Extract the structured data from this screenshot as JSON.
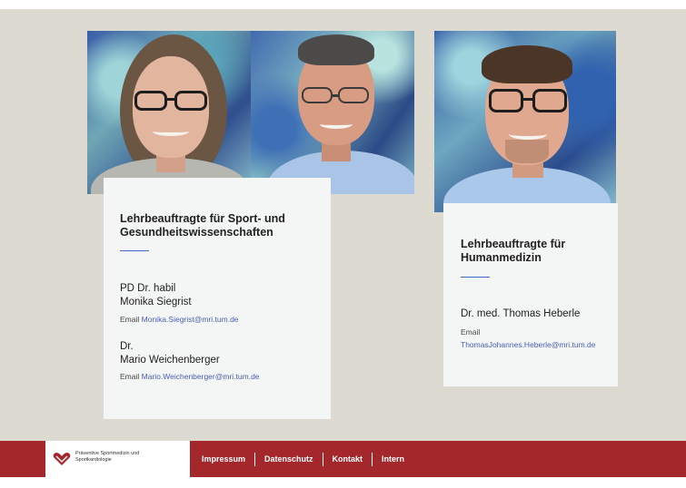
{
  "team": {
    "left_card": {
      "heading": "Lehrbeauftragte für Sport- und Gesundheitswissenschaften",
      "people": [
        {
          "title": "PD Dr. habil",
          "name": "Monika Siegrist",
          "email_label": "Email",
          "email": "Monika.Siegrist@mri.tum.de"
        },
        {
          "title": "Dr.",
          "name": "Mario Weichenberger",
          "email_label": "Email",
          "email": "Mario.Weichenberger@mri.tum.de"
        }
      ]
    },
    "right_card": {
      "heading": "Lehrbeauftragte für Humanmedizin",
      "person": {
        "name": "Dr. med. Thomas Heberle",
        "email_label": "Email",
        "email": "ThomasJohannes.Heberle@mri.tum.de"
      }
    }
  },
  "footer": {
    "logo_text": "Präventive Sportmedizin und Sportkardiologie",
    "nav": [
      "Impressum",
      "Datenschutz",
      "Kontakt",
      "Intern"
    ]
  },
  "colors": {
    "background": "#dcdad1",
    "footer": "#a4272c",
    "link": "#4a5fb5",
    "rule": "#3f67c7"
  }
}
